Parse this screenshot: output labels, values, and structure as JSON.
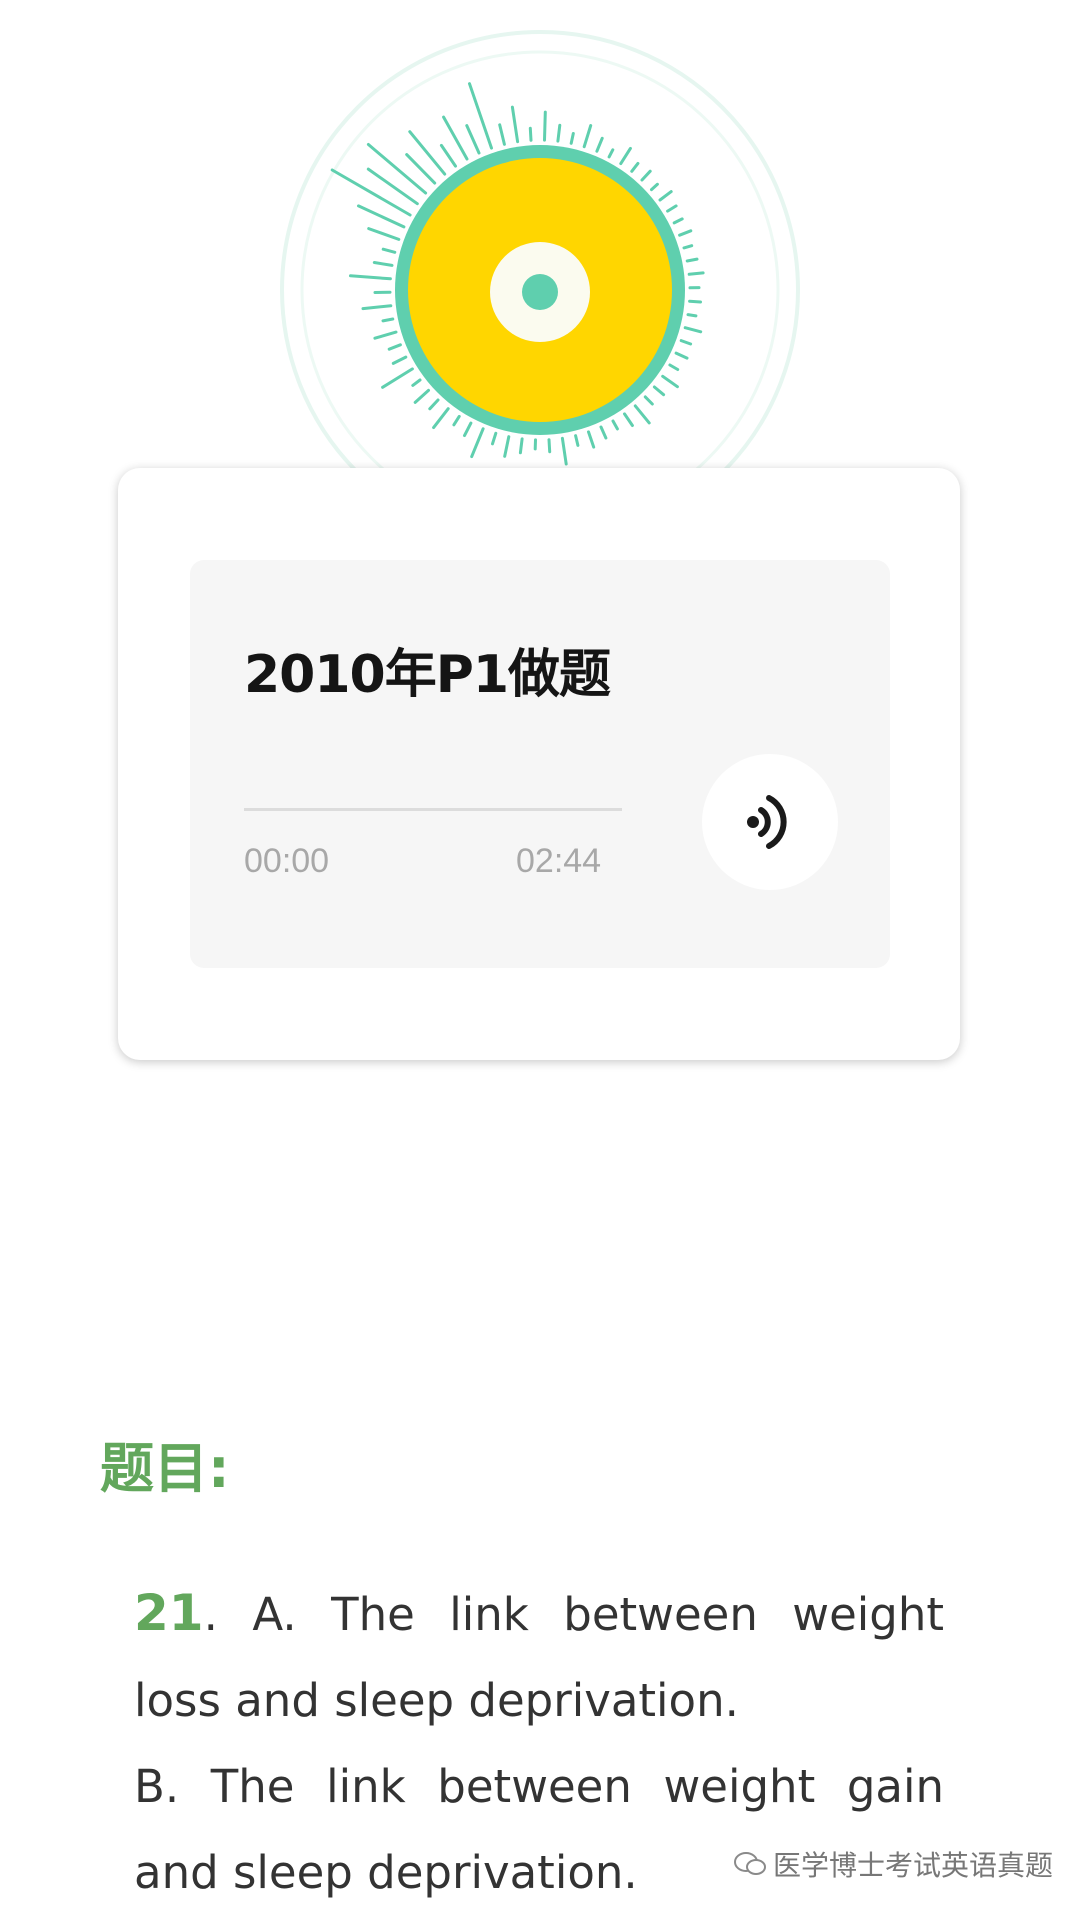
{
  "audio": {
    "title": "2010年P1做题",
    "current_time": "00:00",
    "total_time": "02:44",
    "progress": 0
  },
  "section": {
    "heading": "题目:"
  },
  "question": {
    "number": "21",
    "sep": ".",
    "option_a_line1": "A. The link between weight",
    "option_a_line2": "loss and sleep deprivation.",
    "option_b_line1": "B. The link between weight gain",
    "option_b_line2": "and sleep deprivation."
  },
  "watermark": {
    "text": "医学博士考试英语真题"
  },
  "colors": {
    "accent_green": "#62a75c",
    "teal": "#5fcfae",
    "yellow": "#ffd600"
  },
  "icons": {
    "speaker": "sound-wave-icon",
    "watermark": "wechat-icon"
  }
}
